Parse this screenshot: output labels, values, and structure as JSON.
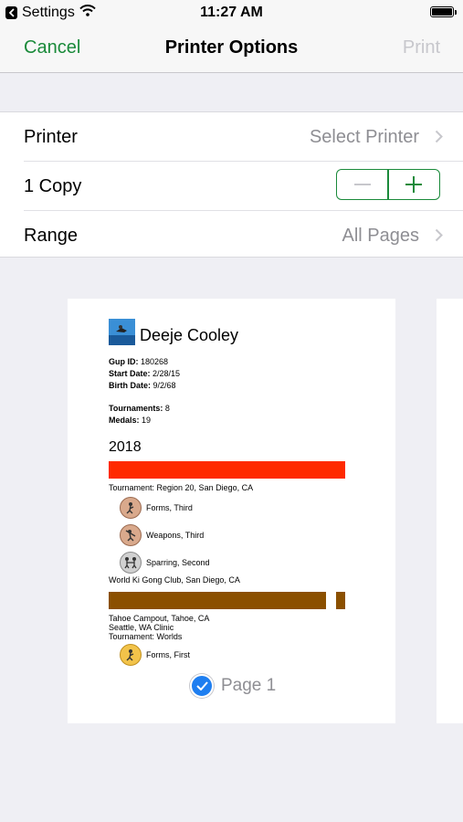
{
  "status": {
    "back_app": "Settings",
    "time": "11:27 AM"
  },
  "nav": {
    "cancel": "Cancel",
    "title": "Printer Options",
    "print": "Print"
  },
  "options": {
    "printer_label": "Printer",
    "printer_value": "Select Printer",
    "copies_label": "1 Copy",
    "range_label": "Range",
    "range_value": "All Pages"
  },
  "preview": {
    "name": "Deeje Cooley",
    "gup_label": "Gup ID:",
    "gup_value": "180268",
    "start_label": "Start Date:",
    "start_value": "2/28/15",
    "birth_label": "Birth Date:",
    "birth_value": "9/2/68",
    "tournaments_label": "Tournaments:",
    "tournaments_value": "8",
    "medals_label": "Medals:",
    "medals_value": "19",
    "year": "2018",
    "tournament1": "Tournament: Region 20, San Diego, CA",
    "medal1": "Forms, Third",
    "medal2": "Weapons, Third",
    "medal3": "Sparring, Second",
    "event2": "World Ki Gong Club, San Diego, CA",
    "event3": "Tahoe Campout, Tahoe, CA",
    "event4": "Seattle, WA Clinic",
    "tournament2": "Tournament: Worlds",
    "medal4": "Forms, First",
    "page_label": "Page 1"
  },
  "colors": {
    "accent": "#1a8a3a",
    "red_bar": "#ff2a00",
    "brown_bar": "#8b5000",
    "check": "#1e7ef0"
  }
}
